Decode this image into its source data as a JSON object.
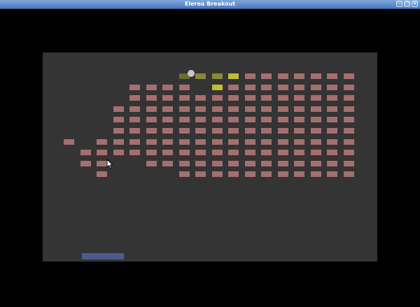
{
  "window": {
    "title": "Elerea Breakout",
    "buttons": [
      "minimize-button",
      "maximize-button",
      "close-button"
    ]
  },
  "colors": {
    "brick": "#a56f6d",
    "brick_hit_dim": "#6d6b2a",
    "brick_hit_mid": "#8a8a36",
    "brick_hit_bright": "#bfbf2f",
    "field": "#343434",
    "paddle": "#4b5b8c",
    "ball": "#c8c8c8"
  },
  "grid": {
    "cols": 18,
    "rows": 10
  },
  "bricks": [
    [
      0,
      7,
      "dim"
    ],
    [
      0,
      8,
      "mid"
    ],
    [
      0,
      9,
      "mid"
    ],
    [
      0,
      10,
      "bright"
    ],
    [
      0,
      11
    ],
    [
      0,
      12
    ],
    [
      0,
      13
    ],
    [
      0,
      14
    ],
    [
      0,
      15
    ],
    [
      0,
      16
    ],
    [
      0,
      17
    ],
    [
      1,
      4
    ],
    [
      1,
      5
    ],
    [
      1,
      6
    ],
    [
      1,
      7
    ],
    [
      1,
      9,
      "bright"
    ],
    [
      1,
      10
    ],
    [
      1,
      11
    ],
    [
      1,
      12
    ],
    [
      1,
      13
    ],
    [
      1,
      14
    ],
    [
      1,
      15
    ],
    [
      1,
      16
    ],
    [
      1,
      17
    ],
    [
      2,
      4
    ],
    [
      2,
      5
    ],
    [
      2,
      6
    ],
    [
      2,
      7
    ],
    [
      2,
      8
    ],
    [
      2,
      9
    ],
    [
      2,
      10
    ],
    [
      2,
      11
    ],
    [
      2,
      12
    ],
    [
      2,
      13
    ],
    [
      2,
      14
    ],
    [
      2,
      15
    ],
    [
      2,
      16
    ],
    [
      2,
      17
    ],
    [
      3,
      3
    ],
    [
      3,
      4
    ],
    [
      3,
      5
    ],
    [
      3,
      6
    ],
    [
      3,
      7
    ],
    [
      3,
      8
    ],
    [
      3,
      9
    ],
    [
      3,
      10
    ],
    [
      3,
      11
    ],
    [
      3,
      12
    ],
    [
      3,
      13
    ],
    [
      3,
      14
    ],
    [
      3,
      15
    ],
    [
      3,
      16
    ],
    [
      3,
      17
    ],
    [
      4,
      3
    ],
    [
      4,
      4
    ],
    [
      4,
      5
    ],
    [
      4,
      6
    ],
    [
      4,
      7
    ],
    [
      4,
      8
    ],
    [
      4,
      9
    ],
    [
      4,
      10
    ],
    [
      4,
      11
    ],
    [
      4,
      12
    ],
    [
      4,
      13
    ],
    [
      4,
      14
    ],
    [
      4,
      15
    ],
    [
      4,
      16
    ],
    [
      4,
      17
    ],
    [
      5,
      3
    ],
    [
      5,
      4
    ],
    [
      5,
      5
    ],
    [
      5,
      6
    ],
    [
      5,
      7
    ],
    [
      5,
      8
    ],
    [
      5,
      9
    ],
    [
      5,
      10
    ],
    [
      5,
      11
    ],
    [
      5,
      12
    ],
    [
      5,
      13
    ],
    [
      5,
      14
    ],
    [
      5,
      15
    ],
    [
      5,
      16
    ],
    [
      5,
      17
    ],
    [
      6,
      0
    ],
    [
      6,
      2
    ],
    [
      6,
      3
    ],
    [
      6,
      4
    ],
    [
      6,
      5
    ],
    [
      6,
      6
    ],
    [
      6,
      7
    ],
    [
      6,
      8
    ],
    [
      6,
      9
    ],
    [
      6,
      10
    ],
    [
      6,
      11
    ],
    [
      6,
      12
    ],
    [
      6,
      13
    ],
    [
      6,
      14
    ],
    [
      6,
      15
    ],
    [
      6,
      16
    ],
    [
      6,
      17
    ],
    [
      7,
      1
    ],
    [
      7,
      2
    ],
    [
      7,
      3
    ],
    [
      7,
      4
    ],
    [
      7,
      5
    ],
    [
      7,
      6
    ],
    [
      7,
      7
    ],
    [
      7,
      8
    ],
    [
      7,
      9
    ],
    [
      7,
      10
    ],
    [
      7,
      11
    ],
    [
      7,
      12
    ],
    [
      7,
      13
    ],
    [
      7,
      14
    ],
    [
      7,
      15
    ],
    [
      7,
      16
    ],
    [
      7,
      17
    ],
    [
      8,
      1
    ],
    [
      8,
      2
    ],
    [
      8,
      5
    ],
    [
      8,
      6
    ],
    [
      8,
      7
    ],
    [
      8,
      8
    ],
    [
      8,
      9
    ],
    [
      8,
      10
    ],
    [
      8,
      11
    ],
    [
      8,
      12
    ],
    [
      8,
      13
    ],
    [
      8,
      14
    ],
    [
      8,
      15
    ],
    [
      8,
      16
    ],
    [
      8,
      17
    ],
    [
      9,
      2
    ],
    [
      9,
      7
    ],
    [
      9,
      8
    ],
    [
      9,
      9
    ],
    [
      9,
      10
    ],
    [
      9,
      11
    ],
    [
      9,
      12
    ],
    [
      9,
      13
    ],
    [
      9,
      14
    ],
    [
      9,
      15
    ],
    [
      9,
      16
    ],
    [
      9,
      17
    ]
  ]
}
